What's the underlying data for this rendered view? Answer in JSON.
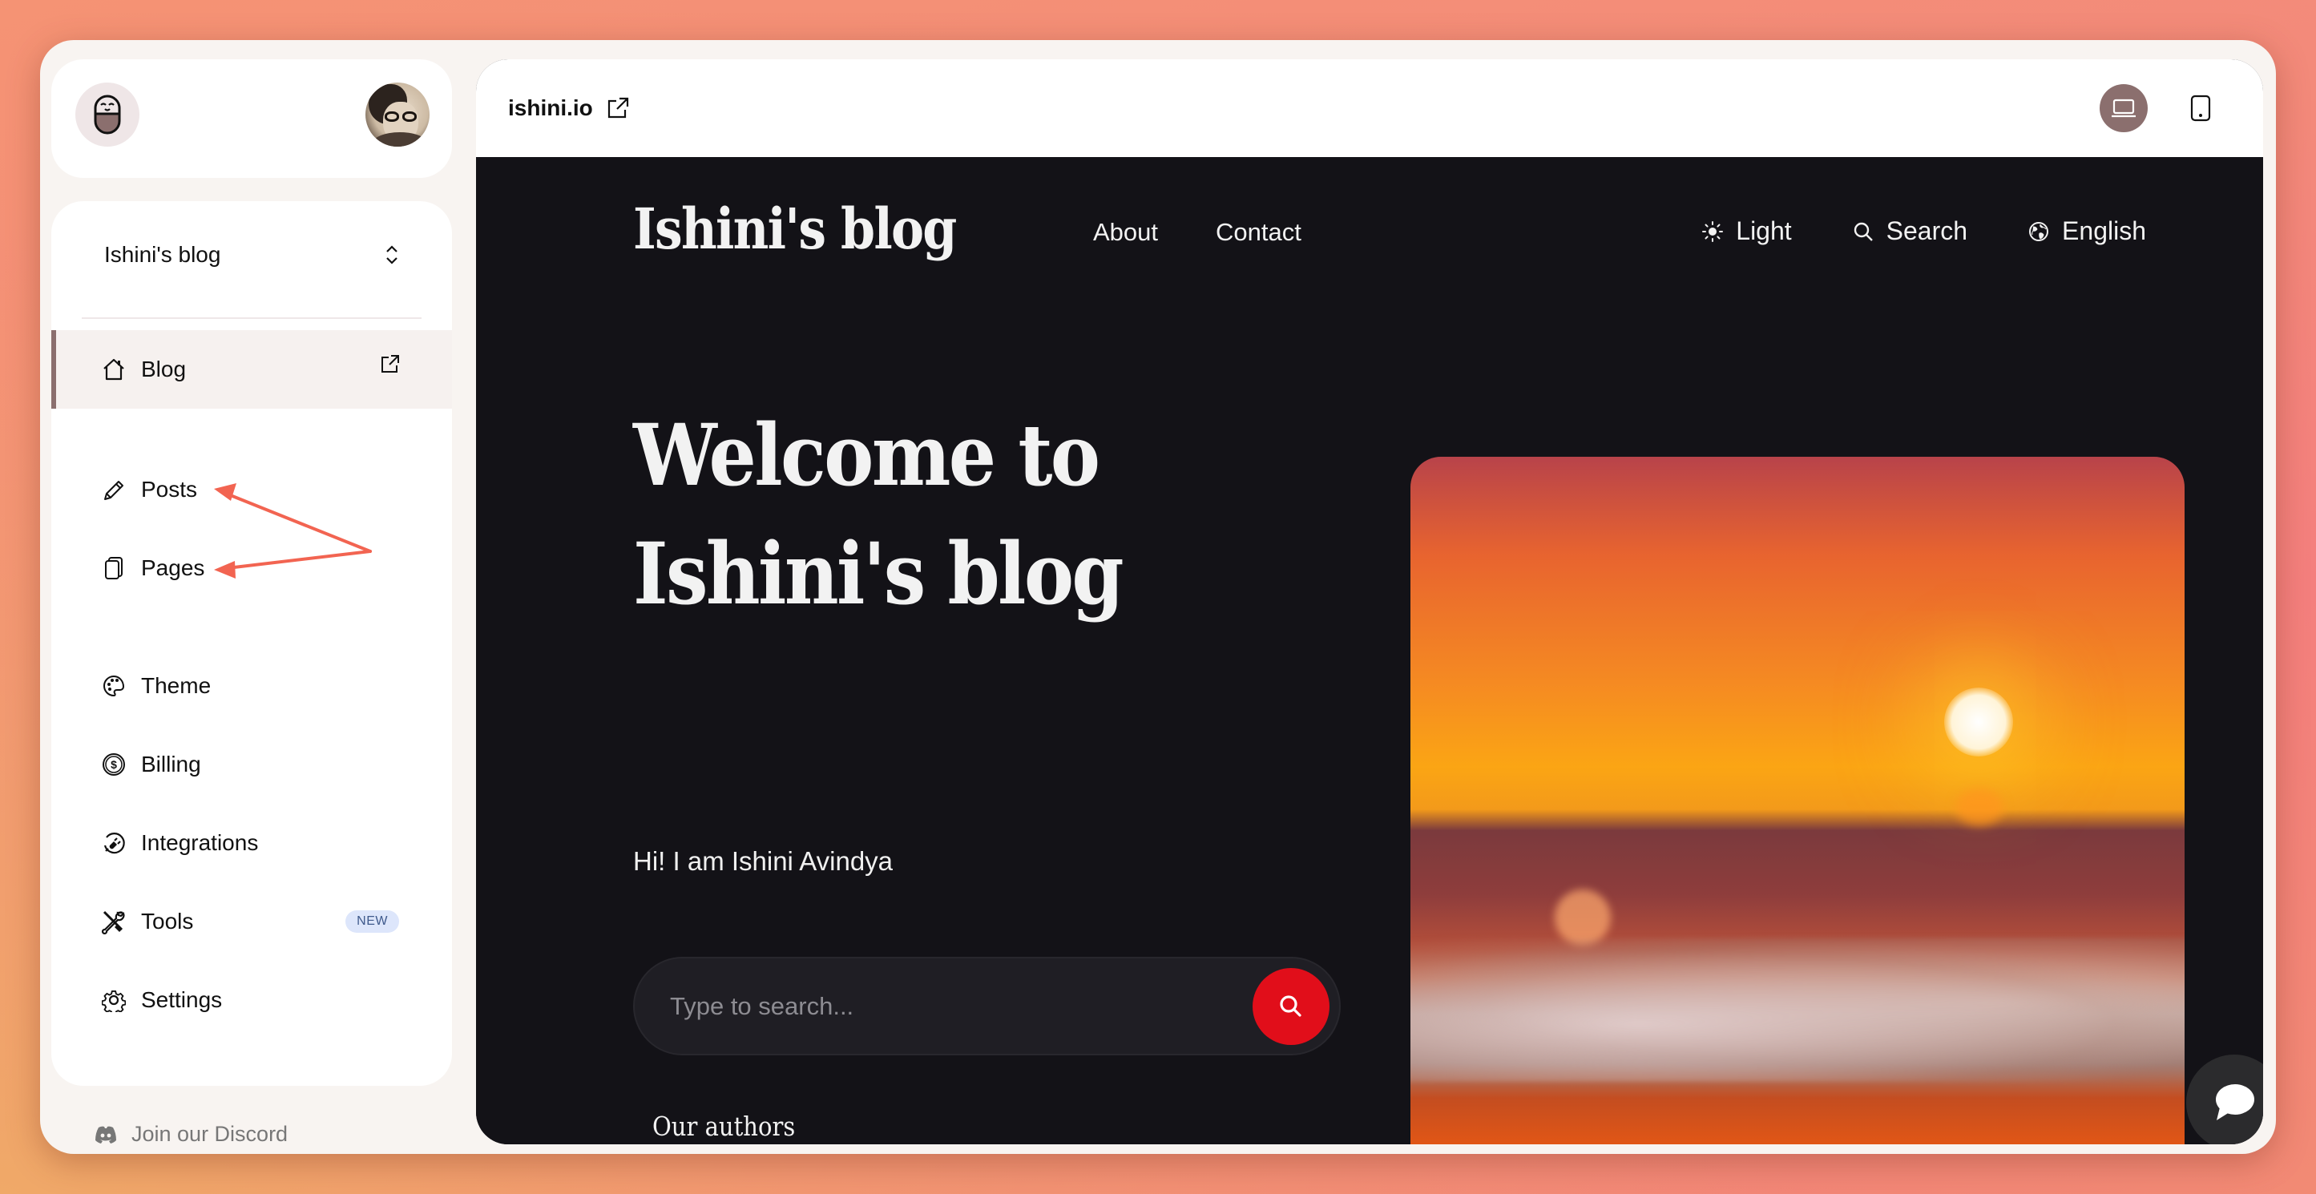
{
  "sidebar": {
    "logo_icon": "capsule-smile-icon",
    "avatar_alt": "user-avatar",
    "site_selector": {
      "label": "Ishini's blog",
      "icon": "chevron-up-down-icon"
    },
    "items": [
      {
        "label": "Blog",
        "icon": "home-icon",
        "active": true,
        "trailing_icon": "external-link-icon"
      },
      {
        "label": "Posts",
        "icon": "pencil-icon"
      },
      {
        "label": "Pages",
        "icon": "pages-icon"
      },
      {
        "label": "Theme",
        "icon": "palette-icon"
      },
      {
        "label": "Billing",
        "icon": "dollar-coin-icon"
      },
      {
        "label": "Integrations",
        "icon": "plug-icon"
      },
      {
        "label": "Tools",
        "icon": "tools-icon",
        "badge": "NEW"
      },
      {
        "label": "Settings",
        "icon": "gear-icon"
      }
    ],
    "footer_link": {
      "label": "Join our Discord",
      "icon": "discord-icon"
    }
  },
  "annotation": {
    "color": "#f26451",
    "targets": [
      "Posts",
      "Pages"
    ]
  },
  "topbar": {
    "domain": "ishini.io",
    "domain_icon": "external-link-icon",
    "device_modes": [
      {
        "name": "desktop",
        "icon": "laptop-icon",
        "active": true
      },
      {
        "name": "mobile",
        "icon": "phone-icon",
        "active": false
      }
    ]
  },
  "preview": {
    "brand": "Ishini's blog",
    "nav": [
      "About",
      "Contact"
    ],
    "nav_right": [
      {
        "label": "Light",
        "icon": "sun-icon"
      },
      {
        "label": "Search",
        "icon": "search-icon"
      },
      {
        "label": "English",
        "icon": "globe-icon"
      }
    ],
    "hero_title_line1": "Welcome to",
    "hero_title_line2": "Ishini's blog",
    "hero_subtitle": "Hi! I am Ishini Avindya",
    "search_placeholder": "Type to search...",
    "section_heading": "Our authors",
    "hero_image": "sunset-ocean-wave-image"
  },
  "chat_widget": {
    "icon": "chat-bubble-icon"
  },
  "colors": {
    "accent": "#8b6f6e",
    "search_button": "#e10e1a",
    "preview_bg": "#131217",
    "badge_bg": "#dde6fb",
    "badge_text": "#3f5a8c"
  }
}
